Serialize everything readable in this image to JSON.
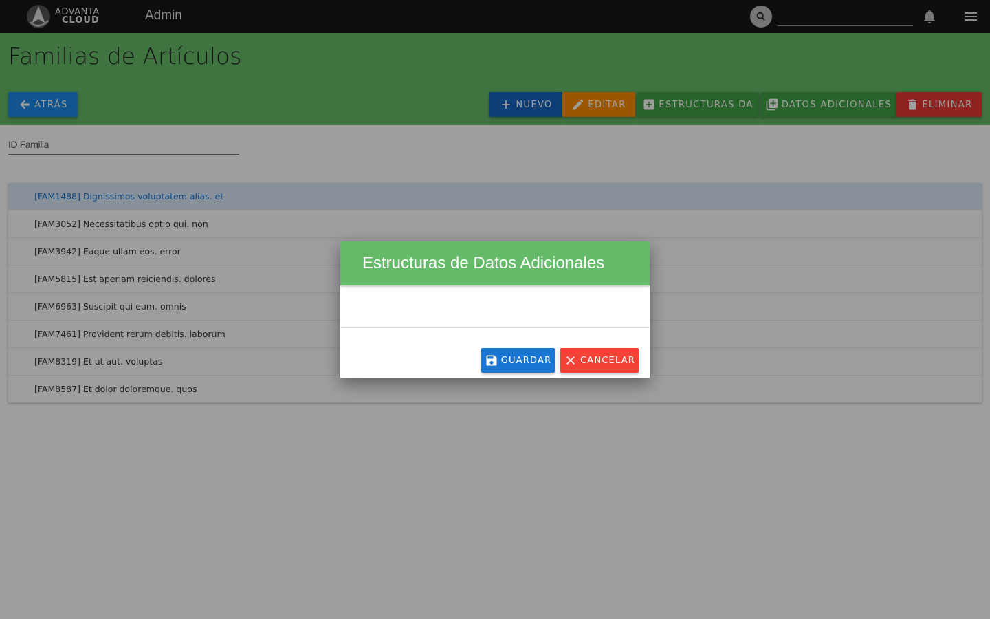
{
  "topbar": {
    "logo_line1": "ADVANTA",
    "logo_line2": "CLOUD",
    "title": "Admin",
    "search_placeholder": ""
  },
  "header": {
    "title": "Familias de Artículos",
    "buttons": {
      "back": "ATRÁS",
      "new": "NUEVO",
      "edit": "EDITAR",
      "structures": "ESTRUCTURAS DA",
      "additional_data": "DATOS ADICIONALES",
      "delete": "ELIMINAR"
    }
  },
  "filter": {
    "label": "ID Familia"
  },
  "list": {
    "items": [
      "[FAM1488] Dignissimos voluptatem alias. et",
      "[FAM3052] Necessitatibus optio qui. non",
      "[FAM3942] Eaque ullam eos. error",
      "[FAM5815] Est aperiam reiciendis. dolores",
      "[FAM6963] Suscipit qui eum. omnis",
      "[FAM7461] Provident rerum debitis. laborum",
      "[FAM8319] Et ut aut. voluptas",
      "[FAM8587] Et dolor doloremque. quos"
    ],
    "selected_index": 0
  },
  "dialog": {
    "title": "Estructuras de Datos Adicionales",
    "save_label": "GUARDAR",
    "cancel_label": "CANCELAR"
  },
  "colors": {
    "topbar": "#171717",
    "header_green": "#66bb6a",
    "primary_blue": "#1e88e5",
    "orange": "#fb8c00",
    "green_button": "#43a047",
    "red": "#e53935"
  }
}
